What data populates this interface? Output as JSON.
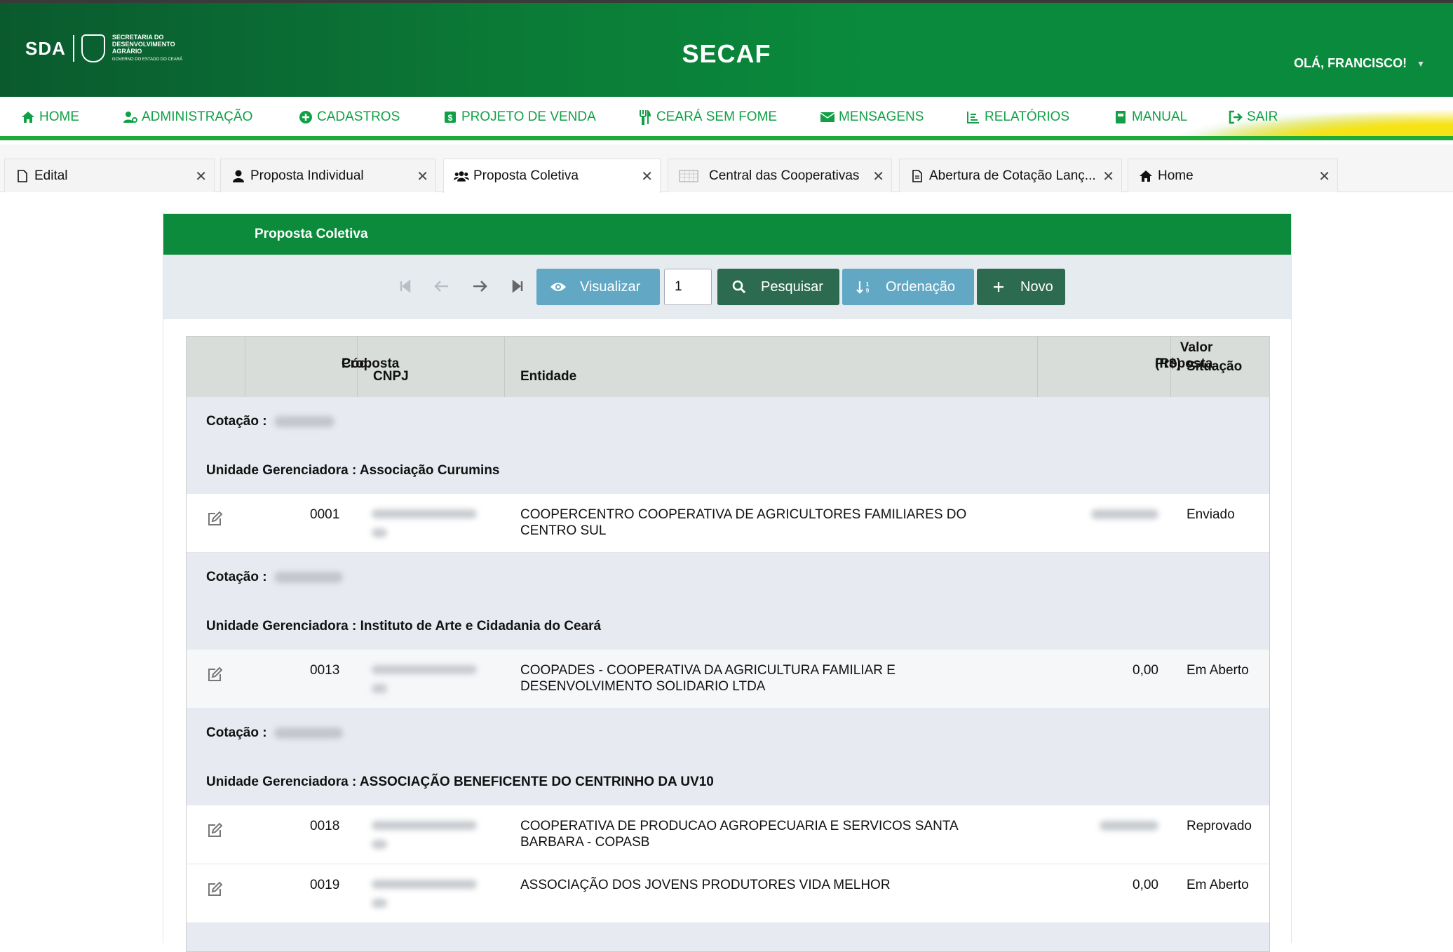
{
  "header": {
    "logo_short": "SDA",
    "logo_line1": "SECRETARIA DO",
    "logo_line2": "DESENVOLVIMENTO",
    "logo_line3": "AGRÁRIO",
    "logo_line4": "GOVERNO DO ESTADO DO CEARÁ",
    "app_title": "SECAF",
    "user_greeting": "OLÁ, FRANCISCO!"
  },
  "nav": [
    {
      "label": "HOME",
      "icon": "home-icon"
    },
    {
      "label": "ADMINISTRAÇÃO",
      "icon": "user-cog-icon"
    },
    {
      "label": "CADASTROS",
      "icon": "plus-circle-icon"
    },
    {
      "label": "PROJETO DE VENDA",
      "icon": "dollar-icon"
    },
    {
      "label": "CEARÁ SEM FOME",
      "icon": "utensils-icon"
    },
    {
      "label": "MENSAGENS",
      "icon": "envelope-icon"
    },
    {
      "label": "RELATÓRIOS",
      "icon": "chart-icon"
    },
    {
      "label": "MANUAL",
      "icon": "book-icon"
    },
    {
      "label": "SAIR",
      "icon": "sign-out-icon"
    }
  ],
  "tabs": [
    {
      "label": "Edital",
      "icon": "file-icon"
    },
    {
      "label": "Proposta Individual",
      "icon": "user-icon"
    },
    {
      "label": "Proposta Coletiva",
      "icon": "users-icon",
      "active": true
    },
    {
      "label": "Central das Cooperativas",
      "icon": "table-icon"
    },
    {
      "label": "Abertura de Cotação Lanç...",
      "icon": "file-text-icon"
    },
    {
      "label": "Home",
      "icon": "home-icon"
    }
  ],
  "panel": {
    "title": "Proposta Coletiva"
  },
  "toolbar": {
    "visualizar": "Visualizar",
    "page": "1",
    "pesquisar": "Pesquisar",
    "ordenacao": "Ordenação",
    "novo": "Novo"
  },
  "table": {
    "headers": {
      "cod_line1": "Cód.",
      "cod_line2": "Proposta",
      "cnpj": "CNPJ",
      "entidade": "Entidade",
      "valor_line1": "Valor Proposta",
      "valor_line2": "(R$)",
      "situacao": "Situação"
    },
    "cotacao_label": "Cotação :",
    "ug_label": "Unidade Gerenciadora :",
    "groups": [
      {
        "unidade": "Associação Curumins",
        "rows": [
          {
            "cod": "0001",
            "entidade_l1": "COOPERCENTRO COOPERATIVA DE AGRICULTORES FAMILIARES DO",
            "entidade_l2": "CENTRO SUL",
            "valor": "",
            "situacao": "Enviado"
          }
        ]
      },
      {
        "unidade": "Instituto de Arte e Cidadania do Ceará",
        "rows": [
          {
            "cod": "0013",
            "entidade_l1": "COOPADES - COOPERATIVA DA AGRICULTURA FAMILIAR E",
            "entidade_l2": "DESENVOLVIMENTO SOLIDARIO LTDA",
            "valor": "0,00",
            "situacao": "Em Aberto"
          }
        ]
      },
      {
        "unidade": "ASSOCIAÇÃO BENEFICENTE DO CENTRINHO DA UV10",
        "rows": [
          {
            "cod": "0018",
            "entidade_l1": "COOPERATIVA DE PRODUCAO AGROPECUARIA E SERVICOS SANTA",
            "entidade_l2": "BARBARA - COPASB",
            "valor": "",
            "situacao": "Reprovado"
          },
          {
            "cod": "0019",
            "entidade_l1": "ASSOCIAÇÃO DOS JOVENS PRODUTORES VIDA MELHOR",
            "entidade_l2": "",
            "valor": "0,00",
            "situacao": "Em Aberto"
          }
        ]
      }
    ]
  }
}
